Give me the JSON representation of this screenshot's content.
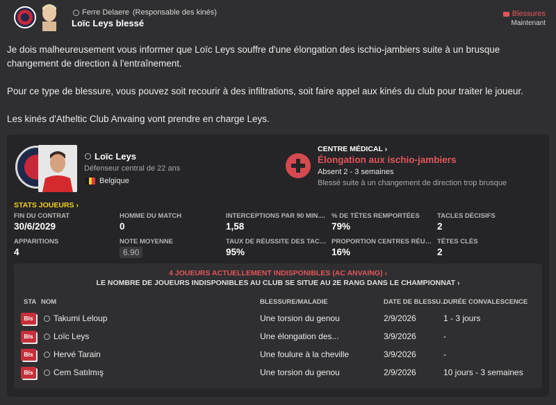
{
  "header": {
    "sender": "Ferre Delaere",
    "sender_role": "(Responsable des kinés)",
    "subject": "Loïc Leys blessé",
    "category": "Blessures",
    "time": "Maintenant"
  },
  "message": {
    "p1": "Je dois malheureusement vous informer que Loïc Leys souffre d'une élongation des ischio-jambiers suite à un brusque changement de direction à l'entraînement.",
    "p2": "Pour ce type de blessure, vous pouvez soit recourir à des infiltrations, soit faire appel aux kinés du club pour traiter le joueur.",
    "p3": "Les kinés d'Atheltic Club Anvaing vont prendre en charge Leys."
  },
  "player": {
    "name": "Loïc Leys",
    "description": "Défenseur central de 22 ans",
    "nationality": "Belgique"
  },
  "medical": {
    "title": "CENTRE MÉDICAL ›",
    "injury": "Élongation aux ischio-jambiers",
    "absence": "Absent 2 - 3 semaines",
    "cause": "Blessé suite à un changement de direction trop brusque"
  },
  "stats": {
    "title": "STATS JOUEURS ›",
    "items": [
      {
        "label": "FIN DU CONTRAT",
        "value": "30/6/2029"
      },
      {
        "label": "HOMME DU MATCH",
        "value": "0"
      },
      {
        "label": "INTERCEPTIONS PAR 90 MIN....",
        "value": "1,58"
      },
      {
        "label": "% DE TÊTES REMPORTÉES",
        "value": "79%"
      },
      {
        "label": "TACLES DÉCISIFS",
        "value": "2"
      },
      {
        "label": "APPARITIONS",
        "value": "4"
      },
      {
        "label": "NOTE MOYENNE",
        "value": "6.90"
      },
      {
        "label": "TAUX DE RÉUSSITE DES TACLES",
        "value": "95%"
      },
      {
        "label": "PROPORTION CENTRES RÉUSS...",
        "value": "16%"
      },
      {
        "label": "TÊTES CLÉS",
        "value": "2"
      }
    ]
  },
  "unavailable": {
    "title": "4 JOUEURS ACTUELLEMENT INDISPONIBLES (AC ANVAING) ›",
    "subtitle": "LE NOMBRE DE JOUEURS INDISPONIBLES AU CLUB SE SITUE AU 2E RANG DANS LE CHAMPIONNAT ›",
    "columns": {
      "sta": "STA",
      "name": "NOM",
      "injury": "BLESSURE/MALADIE",
      "date": "DATE DE BLESSU...",
      "duration": "DURÉE CONVALESCENCE"
    },
    "rows": [
      {
        "status": "Bls",
        "name": "Takumi Leloup",
        "injury": "Une torsion du genou",
        "date": "2/9/2026",
        "duration": "1 - 3 jours"
      },
      {
        "status": "Bls",
        "name": "Loïc Leys",
        "injury": "Une élongation des...",
        "date": "3/9/2026",
        "duration": "-"
      },
      {
        "status": "Bls",
        "name": "Hervé Tarain",
        "injury": "Une foulure à la cheville",
        "date": "3/9/2026",
        "duration": "-"
      },
      {
        "status": "Bls",
        "name": "Cem Satılmış",
        "injury": "Une torsion du genou",
        "date": "2/9/2026",
        "duration": "10 jours - 3 semaines"
      }
    ]
  }
}
